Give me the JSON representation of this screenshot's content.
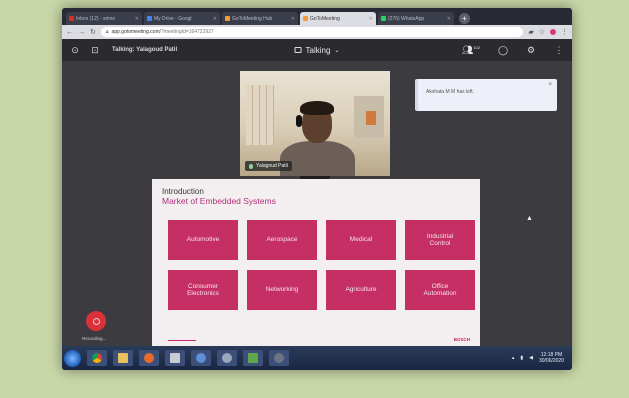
{
  "browser": {
    "tabs": [
      {
        "label": "Inbox (12) - srimo",
        "favicon_color": "#d93025",
        "active": false
      },
      {
        "label": "My Drive - Googl",
        "favicon_color": "#4285f4",
        "active": false
      },
      {
        "label": "GoToMeeting Hub",
        "favicon_color": "#f29b38",
        "active": false
      },
      {
        "label": "GoToMeeting",
        "favicon_color": "#f29b38",
        "active": true
      },
      {
        "label": "(276) WhatsApp",
        "favicon_color": "#25d366",
        "active": false
      }
    ],
    "new_tab": "+",
    "url_host": "app.gotomeeting.com",
    "url_path": "/?meetingId=164722927"
  },
  "meeting": {
    "talking_label": "Talking: Yalagoud Patil",
    "center_label": "Talking",
    "participants_count": "102"
  },
  "video": {
    "participant_name": "Yalagoud Patil"
  },
  "notification": {
    "text": "Akshata M M has left.",
    "close": "×"
  },
  "slide": {
    "title": "Introduction",
    "subtitle": "Market of Embedded Systems",
    "tiles": [
      "Automotive",
      "Aerospace",
      "Medical",
      "Industrial\nControl",
      "Consumer\nElectronics",
      "Networking",
      "Agriculture",
      "Office\nAutomation"
    ],
    "brand": "BOSCH",
    "tile_color": "#c52f63",
    "subtitle_color": "#b1307a"
  },
  "recording": {
    "label": "Recording..."
  },
  "taskbar": {
    "time": "12:18 PM",
    "date": "30/06/2020"
  }
}
